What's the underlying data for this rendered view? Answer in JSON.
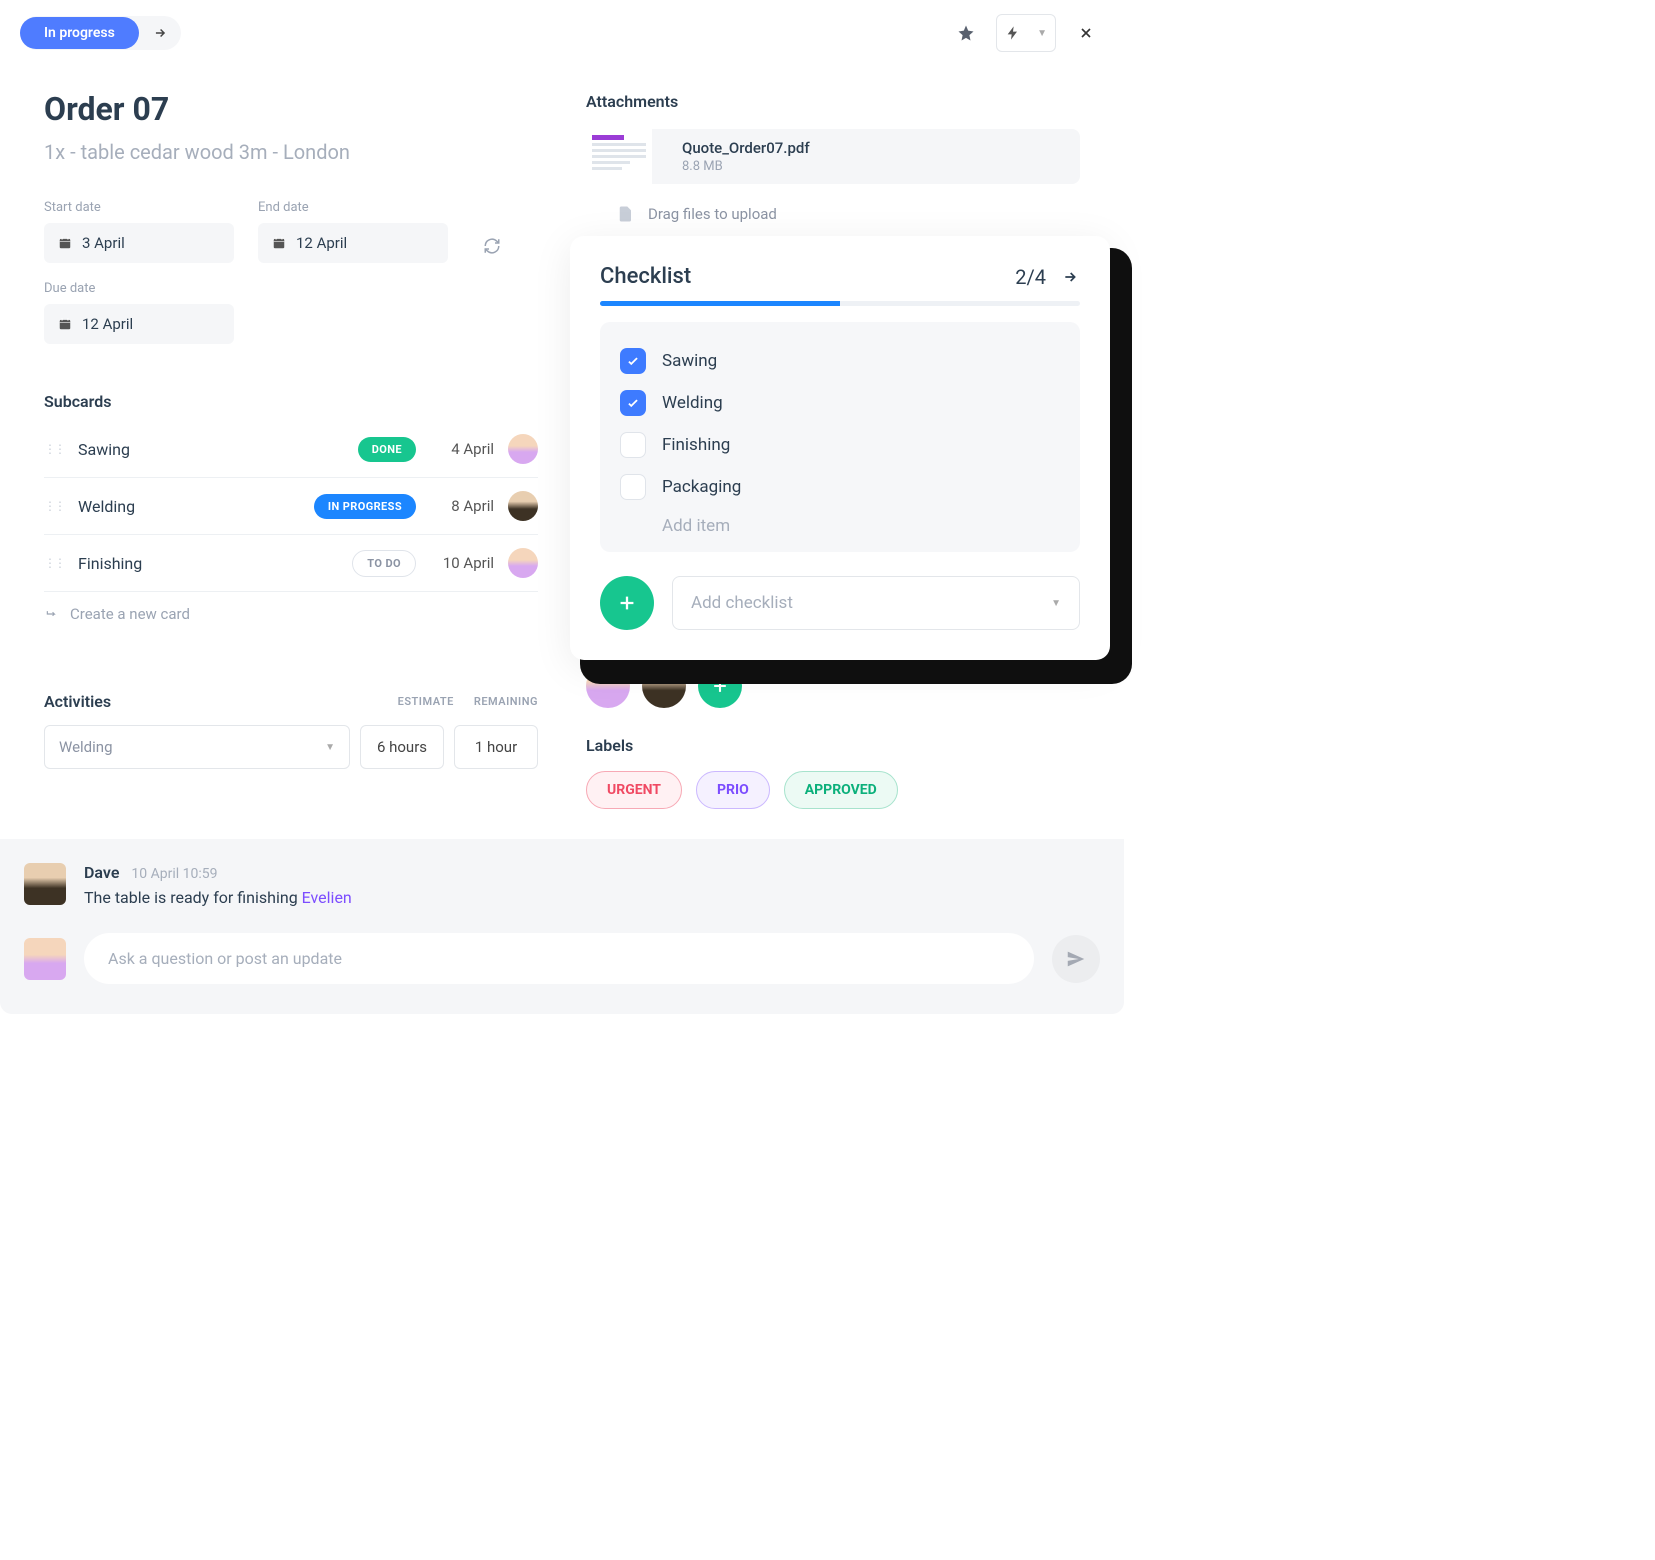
{
  "status": {
    "label": "In progress"
  },
  "order": {
    "title": "Order 07",
    "subtitle": "1x - table cedar wood 3m - London"
  },
  "dates": {
    "start_label": "Start date",
    "end_label": "End date",
    "due_label": "Due date",
    "start": "3 April",
    "end": "12 April",
    "due": "12 April"
  },
  "subcards": {
    "heading": "Subcards",
    "items": [
      {
        "name": "Sawing",
        "status": "DONE",
        "status_class": "badge-done",
        "date": "4 April",
        "avatar": "a1"
      },
      {
        "name": "Welding",
        "status": "IN PROGRESS",
        "status_class": "badge-prog",
        "date": "8 April",
        "avatar": "a2"
      },
      {
        "name": "Finishing",
        "status": "TO DO",
        "status_class": "badge-todo",
        "date": "10 April",
        "avatar": "a1"
      }
    ],
    "create": "Create a new card"
  },
  "activities": {
    "heading": "Activities",
    "col_estimate": "ESTIMATE",
    "col_remaining": "REMAINING",
    "selected": "Welding",
    "estimate": "6 hours",
    "remaining": "1 hour"
  },
  "attachments": {
    "heading": "Attachments",
    "file": {
      "name": "Quote_Order07.pdf",
      "size": "8.8 MB"
    },
    "drop_hint": "Drag files to upload"
  },
  "checklist": {
    "title": "Checklist",
    "count": "2/4",
    "items": [
      {
        "label": "Sawing",
        "done": true
      },
      {
        "label": "Welding",
        "done": true
      },
      {
        "label": "Finishing",
        "done": false
      },
      {
        "label": "Packaging",
        "done": false
      }
    ],
    "add_item": "Add item",
    "add_checklist": "Add checklist"
  },
  "labels": {
    "heading": "Labels",
    "items": [
      {
        "text": "URGENT",
        "cls": "lp-urgent"
      },
      {
        "text": "PRIO",
        "cls": "lp-prio"
      },
      {
        "text": "APPROVED",
        "cls": "lp-approved"
      }
    ]
  },
  "comment": {
    "author": "Dave",
    "time": "10 April 10:59",
    "text": "The table is ready for finishing ",
    "mention": "Evelien"
  },
  "compose": {
    "placeholder": "Ask a question or post an update"
  }
}
